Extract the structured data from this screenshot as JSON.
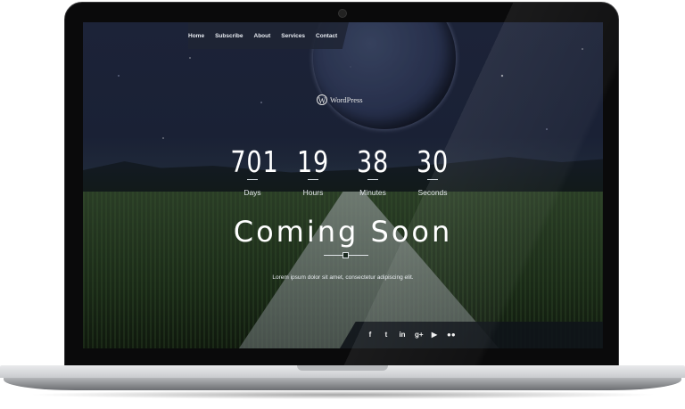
{
  "nav": {
    "items": [
      "Home",
      "Subscribe",
      "About",
      "Services",
      "Contact"
    ]
  },
  "logo": {
    "mark": "W",
    "text": "WordPress"
  },
  "countdown": [
    {
      "value": "701",
      "label": "Days"
    },
    {
      "value": "19",
      "label": "Hours"
    },
    {
      "value": "38",
      "label": "Minutes"
    },
    {
      "value": "30",
      "label": "Seconds"
    }
  ],
  "main": {
    "title": "Coming Soon",
    "tagline": "Lorem ipsum dolor sit amet, consectetur adipiscing elit."
  },
  "social": {
    "icons": [
      {
        "name": "facebook-icon",
        "glyph": "f"
      },
      {
        "name": "twitter-icon",
        "glyph": "t"
      },
      {
        "name": "linkedin-icon",
        "glyph": "in"
      },
      {
        "name": "googleplus-icon",
        "glyph": "g+"
      },
      {
        "name": "youtube-icon",
        "glyph": "▶"
      },
      {
        "name": "flickr-icon",
        "glyph": "●●"
      }
    ]
  }
}
